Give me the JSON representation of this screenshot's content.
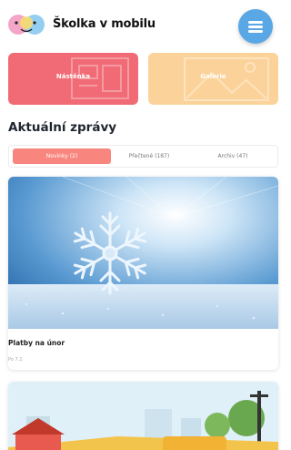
{
  "header": {
    "app_name": "Školka v mobilu",
    "logo_icon": "face-logo-icon",
    "menu_icon": "hamburger-menu-icon"
  },
  "tiles": [
    {
      "label": "Nástěnka",
      "color": "#f06b76",
      "icon": "noticeboard-icon"
    },
    {
      "label": "Galerie",
      "color": "#fbd29a",
      "icon": "gallery-icon"
    }
  ],
  "news": {
    "title": "Aktuální zprávy",
    "tabs": [
      {
        "label": "Novinky (2)",
        "active": true
      },
      {
        "label": "Přečtené (187)",
        "active": false
      },
      {
        "label": "Archiv (47)",
        "active": false
      }
    ],
    "accent_color": "#f8867e",
    "items": [
      {
        "title": "Platby na únor",
        "meta": "Po 7.2.",
        "image": "snowflake-photo"
      },
      {
        "title": "",
        "meta": "",
        "image": "kindergarten-illustration"
      }
    ]
  }
}
